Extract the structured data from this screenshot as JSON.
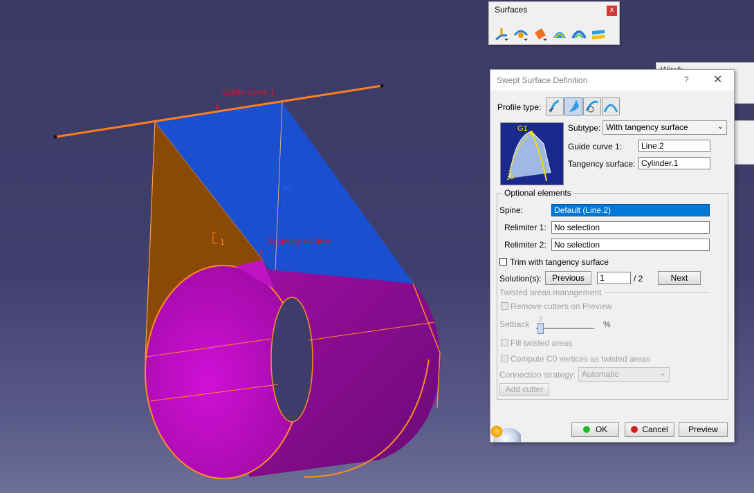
{
  "viewport": {
    "labels": {
      "guide_curve": "Guide curve 1",
      "tangency_surface": "Tangency surface",
      "marker_1": "1",
      "marker_2": "(2)"
    }
  },
  "surfaces_toolbar": {
    "title": "Surfaces",
    "close": "x",
    "icons": [
      "extrude-icon",
      "revolve-icon",
      "offset-icon",
      "sweep-icon",
      "fill-icon",
      "blend-icon"
    ]
  },
  "dialog": {
    "title": "Swept Surface Definition",
    "help": "?",
    "close": "✕",
    "profile_type_label": "Profile type:",
    "profile_type_selected": 2,
    "preview_labels": {
      "g1": "G1",
      "s": "S"
    },
    "subtype_label": "Subtype:",
    "subtype_value": "With tangency surface",
    "guide_curve_label": "Guide curve 1:",
    "guide_curve_value": "Line.2",
    "tangency_surface_label": "Tangency surface:",
    "tangency_surface_value": "Cylinder.1",
    "optional_title": "Optional elements",
    "spine_label": "Spine:",
    "spine_value": "Default (Line.2)",
    "relimiter1_label": "Relimiter 1:",
    "relimiter1_value": "No selection",
    "relimiter2_label": "Relimiter 2:",
    "relimiter2_value": "No selection",
    "trim_label": "Trim with tangency surface",
    "trim_checked": false,
    "solutions_label": "Solution(s):",
    "previous_label": "Previous",
    "solution_current": "1",
    "solution_total": "/ 2",
    "next_label": "Next",
    "twisted_title": "Twisted areas management",
    "remove_cutters_label": "Remove cutters on Preview",
    "setback_label": "Setback",
    "setback_value": "2",
    "setback_unit": "%",
    "fill_twisted_label": "Fill twisted areas",
    "compute_c0_label": "Compute C0 vertices as twisted areas",
    "connection_strategy_label": "Connection strategy:",
    "connection_strategy_value": "Automatic",
    "add_cutter_label": "Add cutter",
    "ok_label": "OK",
    "cancel_label": "Cancel",
    "preview_label": "Preview"
  },
  "colors": {
    "guide_line": "#ff7f1e",
    "swept_blue": "#1a4fd0",
    "swept_brown": "#8a4a06",
    "cylinder_magenta": "#8a0a8c",
    "annotation_red": "#e01818",
    "spine_highlight": "#0078d7"
  }
}
